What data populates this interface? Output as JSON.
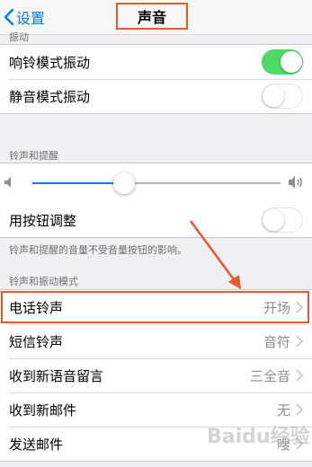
{
  "nav": {
    "back_label": "设置",
    "title": "声音"
  },
  "sections": {
    "vibration": {
      "header": "振动",
      "rows": [
        {
          "label": "响铃模式振动",
          "toggle": "on"
        },
        {
          "label": "静音模式振动",
          "toggle": "off"
        }
      ]
    },
    "ringer": {
      "header": "铃声和提醒",
      "volume_level": 0.37,
      "button_adjust_label": "用按钮调整",
      "button_adjust_toggle": "off",
      "footnote": "铃声和提醒的音量不受音量按钮的影响。"
    },
    "patterns": {
      "header": "铃声和振动模式",
      "rows": [
        {
          "label": "电话铃声",
          "value": "开场"
        },
        {
          "label": "短信铃声",
          "value": "音符"
        },
        {
          "label": "收到新语音留言",
          "value": "三全音"
        },
        {
          "label": "收到新邮件",
          "value": "无"
        },
        {
          "label": "发送邮件",
          "value": "嗖"
        }
      ]
    }
  },
  "colors": {
    "accent": "#007aff",
    "toggle_on": "#4cd964",
    "annotation": "#e8582a"
  },
  "icons": [
    "chevron-left-icon",
    "speaker-low-icon",
    "speaker-high-icon",
    "chevron-right-icon"
  ]
}
